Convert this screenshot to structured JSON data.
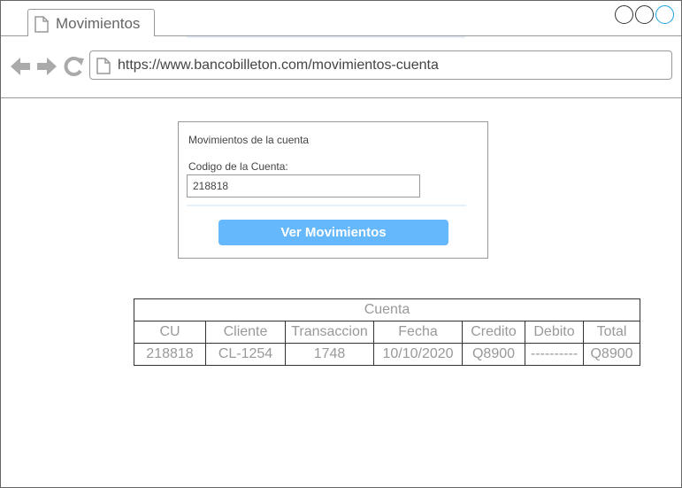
{
  "browser": {
    "tab_title": "Movimientos",
    "url": "https://www.bancobilleton.com/movimientos-cuenta"
  },
  "form": {
    "title": "Movimientos de la cuenta",
    "account_label": "Codigo de la Cuenta:",
    "account_value": "218818",
    "submit_label": "Ver Movimientos"
  },
  "table": {
    "caption": "Cuenta",
    "headers": [
      "CU",
      "Cliente",
      "Transaccion",
      "Fecha",
      "Credito",
      "Debito",
      "Total"
    ],
    "rows": [
      [
        "218818",
        "CL-1254",
        "1748",
        "10/10/2020",
        "Q8900",
        "----------",
        "Q8900"
      ]
    ]
  },
  "colors": {
    "button": "#66b8fc",
    "text_muted": "#999999",
    "accent_control": "#1ba1e2"
  }
}
